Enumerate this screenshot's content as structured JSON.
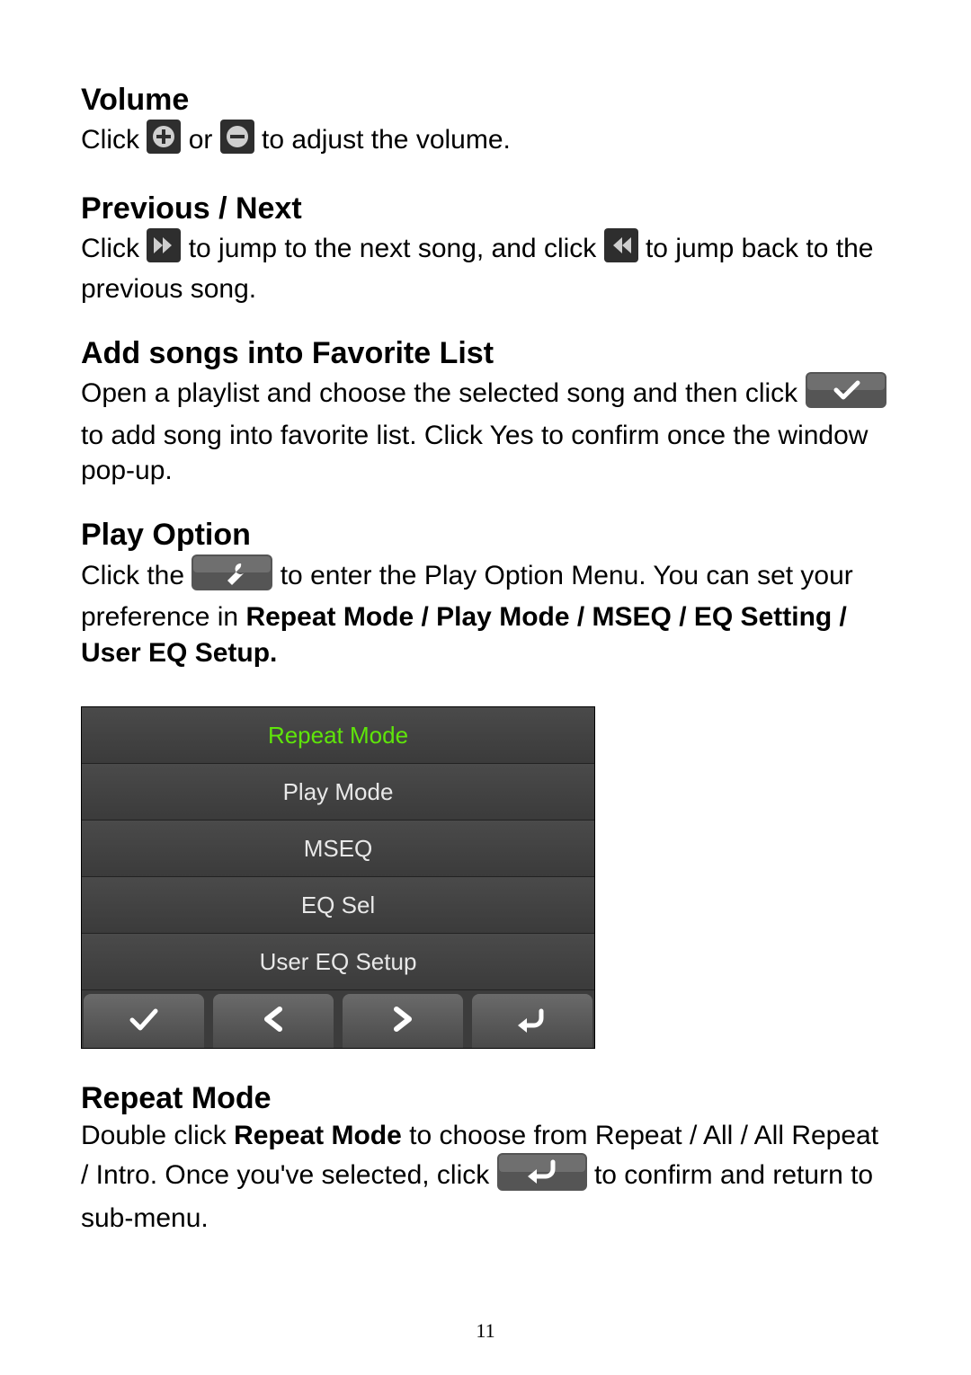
{
  "sections": {
    "volume": {
      "heading": "Volume",
      "text_before_plus": "Click ",
      "text_between": " or ",
      "text_after": " to adjust the volume."
    },
    "prevnext": {
      "heading": "Previous / Next",
      "text_before_next": "Click ",
      "text_mid": " to jump to the next song, and click ",
      "text_after": " to jump back to the previous song."
    },
    "favorite": {
      "heading": "Add songs into Favorite List",
      "text_before": "Open a playlist and choose the selected song and then click ",
      "text_after": " to add song into favorite list. Click Yes to confirm once the window pop-up."
    },
    "playoption": {
      "heading": "Play Option",
      "text_before": "Click the ",
      "text_after_a": " to enter the Play Option Menu. You can set your preference in ",
      "bold_list": "Repeat Mode / Play Mode / MSEQ / EQ Setting / User EQ Setup."
    },
    "repeatmode": {
      "heading": "Repeat Mode",
      "text_a": "Double click ",
      "bold_a": "Repeat Mode",
      "text_b": " to choose from Repeat / All / All Repeat / Intro. Once you've selected, click ",
      "text_c": " to confirm and return to sub-menu."
    }
  },
  "menu": {
    "items": [
      "Repeat Mode",
      "Play Mode",
      "MSEQ",
      "EQ Sel",
      "User EQ Setup"
    ]
  },
  "page_number": "11"
}
